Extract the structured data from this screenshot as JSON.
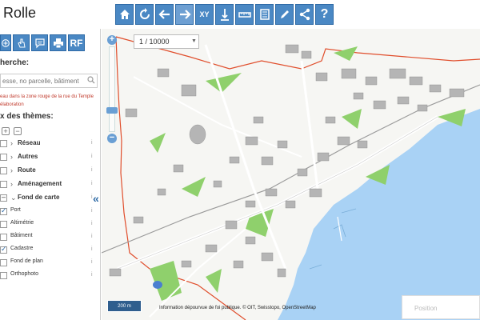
{
  "header": {
    "title": "Rolle",
    "toolbar": [
      {
        "name": "home-button",
        "icon": "home-icon"
      },
      {
        "name": "refresh-button",
        "icon": "refresh-icon"
      },
      {
        "name": "back-button",
        "icon": "arrow-left-icon"
      },
      {
        "name": "forward-button",
        "icon": "arrow-right-icon"
      },
      {
        "name": "coordinates-button",
        "icon": "xy-icon",
        "label": "XY"
      },
      {
        "name": "elevation-button",
        "icon": "elevation-icon"
      },
      {
        "name": "measure-button",
        "icon": "ruler-icon"
      },
      {
        "name": "print-button",
        "icon": "document-icon"
      },
      {
        "name": "draw-button",
        "icon": "pencil-icon"
      },
      {
        "name": "share-button",
        "icon": "share-icon"
      },
      {
        "name": "help-button",
        "icon": "help-icon",
        "label": "?"
      }
    ]
  },
  "sidebar": {
    "tools": [
      {
        "name": "add-layer-button",
        "icon": "add-icon"
      },
      {
        "name": "touch-button",
        "icon": "hand-icon"
      },
      {
        "name": "comment-button",
        "icon": "comment-icon"
      },
      {
        "name": "print-sidebar-button",
        "icon": "printer-icon"
      },
      {
        "name": "rf-button",
        "label": "RF"
      }
    ],
    "search_title": "herche:",
    "search_placeholder": "esse, no parcelle, bâtiment",
    "notice_line1": "eau dans la zone rouge de la rue du Temple",
    "notice_line2": "élaboration",
    "themes_title": "x des thèmes:",
    "layers": [
      {
        "label": "Réseau",
        "type": "group",
        "state": "unchecked"
      },
      {
        "label": "Autres",
        "type": "group",
        "state": "unchecked"
      },
      {
        "label": "Route",
        "type": "group",
        "state": "unchecked"
      },
      {
        "label": "Aménagement",
        "type": "group",
        "state": "unchecked"
      },
      {
        "label": "Fond de carte",
        "type": "group-open",
        "state": "partial"
      },
      {
        "label": "Port",
        "type": "leaf",
        "state": "checked"
      },
      {
        "label": "Altimétrie",
        "type": "leaf",
        "state": "unchecked"
      },
      {
        "label": "Bâtiment",
        "type": "leaf",
        "state": "unchecked"
      },
      {
        "label": "Cadastre",
        "type": "leaf",
        "state": "checked"
      },
      {
        "label": "Fond de plan",
        "type": "leaf",
        "state": "unchecked"
      },
      {
        "label": "Orthophoto",
        "type": "leaf",
        "state": "unchecked"
      }
    ]
  },
  "map": {
    "scale_value": "1 / 10000",
    "scale_bar": "200 m",
    "attribution": "Information dépourvue de foi publique. © OIT, Swisstopo, OpenStreetMap",
    "position_placeholder": "Position",
    "colors": {
      "water": "#a9d2f5",
      "green": "#8fd06c",
      "building": "#b5b5b5",
      "road": "#ffffff",
      "boundary": "#e04e2c"
    }
  }
}
